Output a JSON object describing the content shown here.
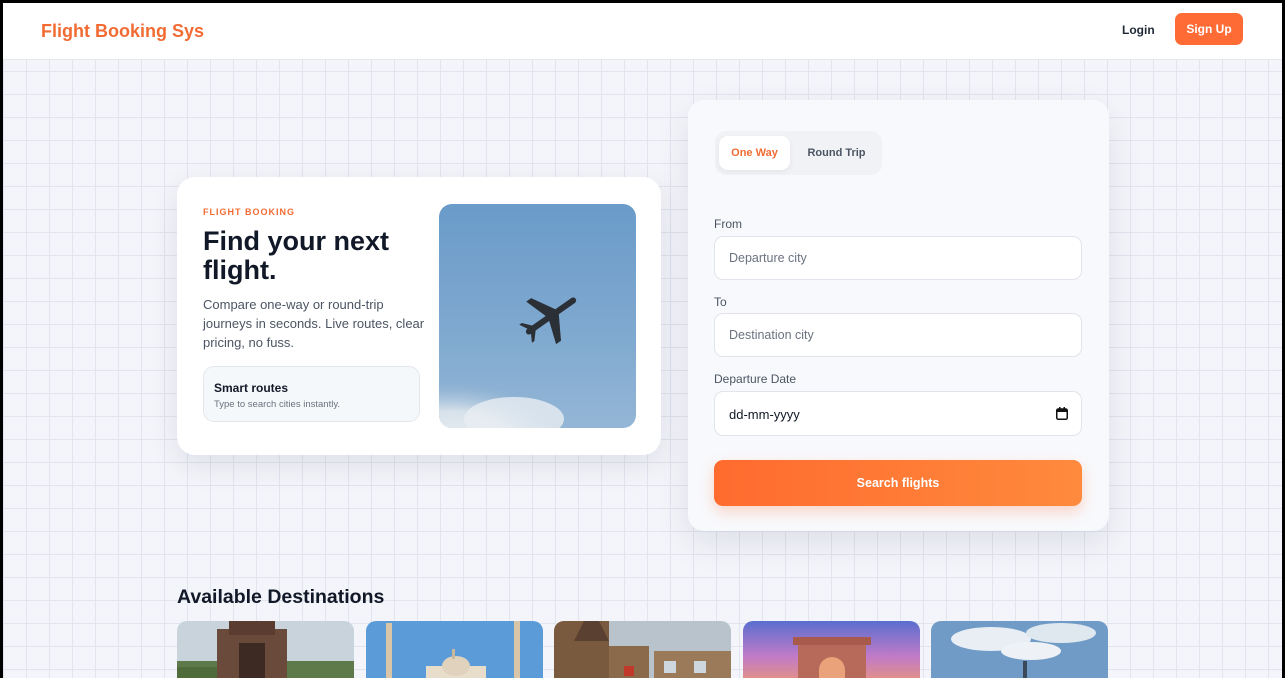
{
  "header": {
    "brand": "Flight Booking Sys",
    "login_label": "Login",
    "signup_label": "Sign Up"
  },
  "hero": {
    "eyebrow": "FLIGHT BOOKING",
    "title": "Find your next flight.",
    "description": "Compare one-way or round-trip journeys in seconds. Live routes, clear pricing, no fuss.",
    "feature_title": "Smart routes",
    "feature_subtitle": "Type to search cities instantly.",
    "image_icon": "airplane-photo"
  },
  "search": {
    "tabs": [
      {
        "label": "One Way",
        "active": true
      },
      {
        "label": "Round Trip",
        "active": false
      }
    ],
    "from_label": "From",
    "from_placeholder": "Departure city",
    "to_label": "To",
    "to_placeholder": "Destination city",
    "date_label": "Departure Date",
    "date_value": "dd-mm-yyyy",
    "date_icon": "calendar-icon",
    "submit_label": "Search flights"
  },
  "destinations": {
    "heading": "Available Destinations",
    "cards": [
      {
        "image": "stone-tower-photo"
      },
      {
        "image": "minaret-palace-photo"
      },
      {
        "image": "gothic-station-photo"
      },
      {
        "image": "india-gate-sunset-photo"
      },
      {
        "image": "city-sky-photo"
      }
    ]
  },
  "colors": {
    "accent": "#ff6b35",
    "brand_text": "#f26b33",
    "background": "#f4f5fa"
  }
}
